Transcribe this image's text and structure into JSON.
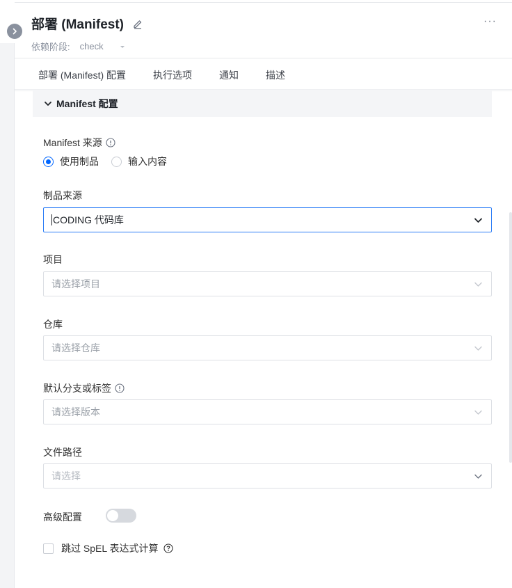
{
  "header": {
    "title": "部署 (Manifest)",
    "dependency_label": "依赖阶段:",
    "dependency_value": "check",
    "more": "···"
  },
  "tabs": [
    {
      "label": "部署 (Manifest) 配置"
    },
    {
      "label": "执行选项"
    },
    {
      "label": "通知"
    },
    {
      "label": "描述"
    }
  ],
  "section": {
    "title": "Manifest 配置"
  },
  "form": {
    "manifest_source_label": "Manifest 来源",
    "radio_use_artifact": "使用制品",
    "radio_input_content": "输入内容",
    "artifact_source_label": "制品来源",
    "artifact_source_value": "CODING 代码库",
    "project_label": "项目",
    "project_placeholder": "请选择项目",
    "repo_label": "仓库",
    "repo_placeholder": "请选择仓库",
    "branch_label": "默认分支或标签",
    "branch_placeholder": "请选择版本",
    "path_label": "文件路径",
    "path_placeholder": "请选择",
    "advanced_label": "高级配置",
    "skip_spel_label": "跳过 SpEL 表达式计算"
  },
  "colors": {
    "accent": "#0066ff",
    "focus_border": "#2a7cf6"
  }
}
